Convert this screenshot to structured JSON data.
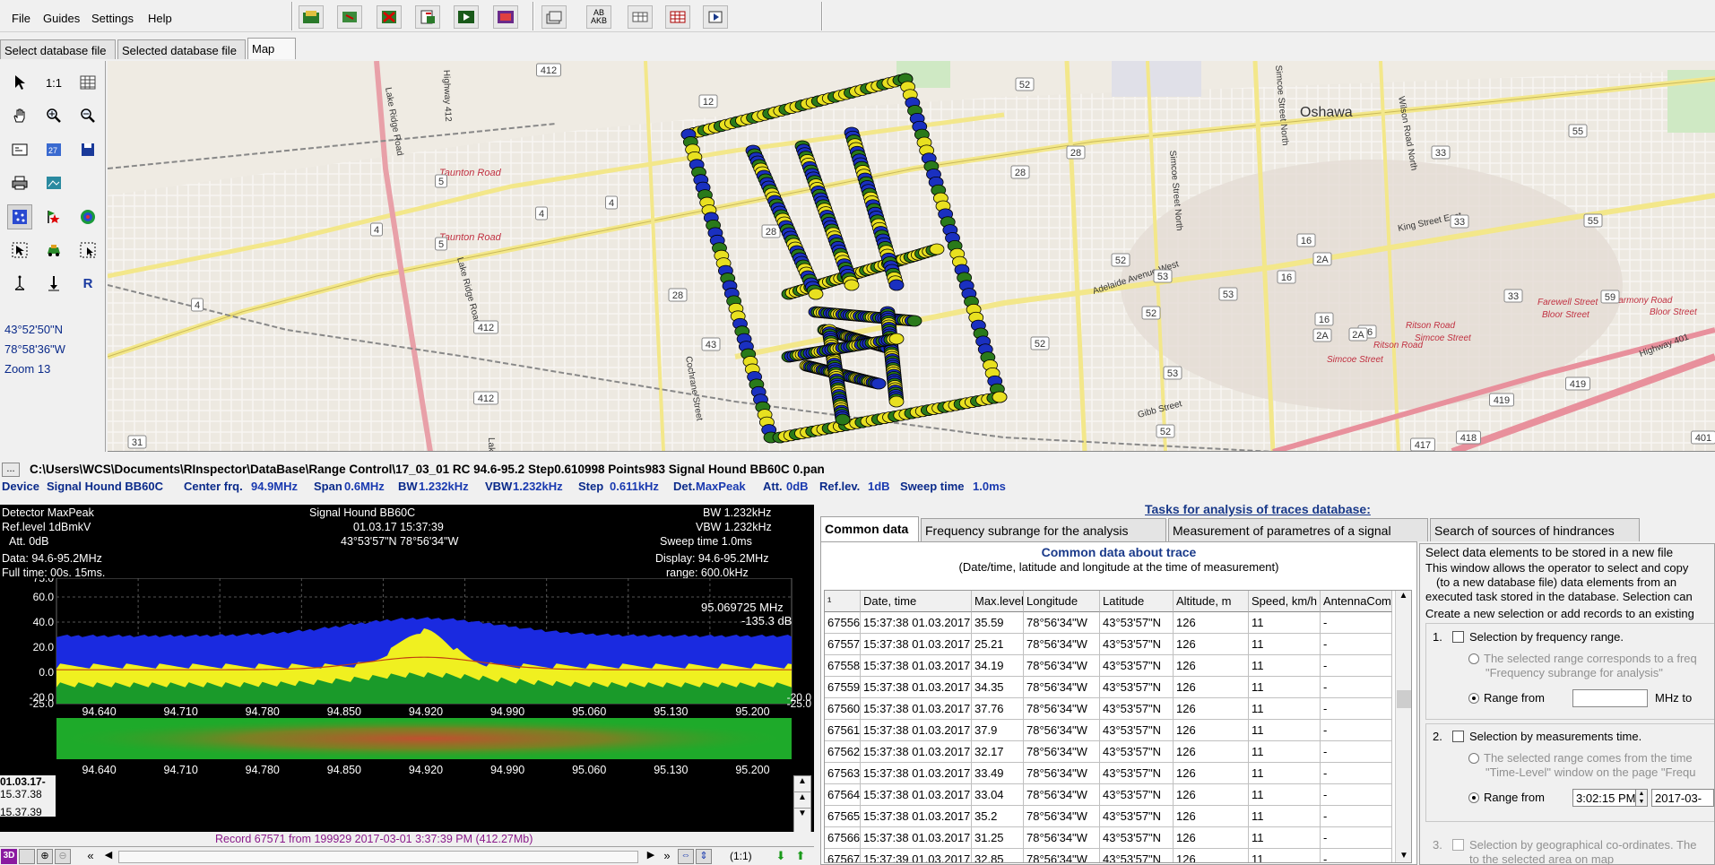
{
  "menu": [
    "File",
    "Guides",
    "Settings",
    "Help"
  ],
  "toolbar": {
    "abc_label": "AB\nAKB"
  },
  "tabs": [
    "Select database file",
    "Selected database file",
    "Map"
  ],
  "left_tools": {
    "scale_label": "1:1",
    "r_label": "R"
  },
  "coords": {
    "lat": "43°52'50\"N",
    "lon": "78°58'36\"W",
    "zoom": "Zoom 13"
  },
  "map": {
    "city": "Oshawa",
    "streets": [
      "Taunton Road",
      "Taunton Road",
      "Lake Ridge Road",
      "Lake Ridge Road",
      "Highway 412",
      "Adelaide Avenue West",
      "King Street East",
      "Gibb Street",
      "Simcoe Street North",
      "Simcoe Street North",
      "Wilson Road North",
      "Cochrane Street",
      "Farewell Street",
      "Bloor Street",
      "Harmony Road",
      "Bloor Street",
      "Ritson Road",
      "Simcoe Street",
      "Ritson Road",
      "Simcoe Street",
      "Highway 401",
      "Lake"
    ],
    "route_badges": [
      "412",
      "12",
      "4",
      "4",
      "4",
      "4",
      "412",
      "5",
      "5",
      "28",
      "28",
      "28",
      "28",
      "52",
      "52",
      "52",
      "52",
      "52",
      "53",
      "53",
      "53",
      "43",
      "16",
      "16",
      "16",
      "16",
      "2A",
      "2A",
      "2A",
      "33",
      "33",
      "33",
      "55",
      "55",
      "59",
      "412",
      "419",
      "419",
      "418",
      "417",
      "401",
      "31"
    ]
  },
  "pathbar": {
    "button": "...",
    "path": "C:\\Users\\WCS\\Documents\\RInspector\\DataBase\\Range Control\\17_03_01 RC 94.6-95.2 Step0.610998 Points983 Signal Hound BB60C 0.pan"
  },
  "devbar": {
    "device_label": "Device",
    "device": "Signal Hound BB60C",
    "center_label": "Center frq.",
    "center": "94.9MHz",
    "span_label": "Span",
    "span": "0.6MHz",
    "bw_label": "BW",
    "bw": "1.232kHz",
    "vbw_label": "VBW",
    "vbw": "1.232kHz",
    "step_label": "Step",
    "step": "0.611kHz",
    "det_label": "Det.",
    "det": "MaxPeak",
    "att_label": "Att.",
    "att": "0dB",
    "ref_label": "Ref.lev.",
    "ref": "1dB",
    "sweep_label": "Sweep time",
    "sweep": "1.0ms"
  },
  "spectrum": {
    "detector": "Detector MaxPeak",
    "reflevel": "Ref.level  1dBmkV",
    "att": "Att.  0dB",
    "data": "Data:     94.6-95.2MHz",
    "fulltime": "Full time:  00s. 15ms.",
    "device": "Signal Hound BB60C",
    "datetime": "01.03.17 15:37:39",
    "location": "43°53'57\"N  78°56'34\"W",
    "bw": "BW   1.232kHz",
    "vbw": "VBW   1.232kHz",
    "sweep": "Sweep time   1.0ms",
    "display": "Display:   94.6-95.2MHz",
    "range": "range:  600.0kHz",
    "marker_freq": "95.069725 MHz",
    "marker_level": "-135.3 dB",
    "y_ticks": [
      "75.0",
      "60.0",
      "40.0",
      "20.0",
      "0.0",
      "-20.0",
      "-25.0"
    ],
    "y_ticks_right": [
      "-20.0",
      "-25.0"
    ],
    "x_ticks": [
      "94.640",
      "94.710",
      "94.780",
      "94.850",
      "94.920",
      "94.990",
      "95.060",
      "95.130",
      "95.200"
    ],
    "wf_label1": "01.03.17-",
    "wf_label2": "15.37.38",
    "wf_label3": "15.37.39",
    "record": "Record 67571  from 199929   2017-03-01 3:37:39 PM (412.27Mb)",
    "ratio": "(1:1)",
    "bottom_3d": "3D"
  },
  "right": {
    "heading": "Tasks for analysis of traces database:",
    "tabs": [
      "Common data",
      "Frequency subrange for the analysis",
      "Measurement of parametres of a signal",
      "Search of sources of hindrances"
    ],
    "title": "Common data about trace",
    "subtitle": "(Date/time, latitude and longitude at the time of measurement)",
    "columns": [
      "¹",
      "Date, time",
      "Max.level",
      "Longitude",
      "Latitude",
      "Altitude, m",
      "Speed, km/h",
      "AntennaCom"
    ],
    "rows": [
      [
        "67556",
        "15:37:38 01.03.2017",
        "35.59",
        "78°56'34\"W",
        "43°53'57\"N",
        "126",
        "11",
        "-"
      ],
      [
        "67557",
        "15:37:38 01.03.2017",
        "25.21",
        "78°56'34\"W",
        "43°53'57\"N",
        "126",
        "11",
        "-"
      ],
      [
        "67558",
        "15:37:38 01.03.2017",
        "34.19",
        "78°56'34\"W",
        "43°53'57\"N",
        "126",
        "11",
        "-"
      ],
      [
        "67559",
        "15:37:38 01.03.2017",
        "34.35",
        "78°56'34\"W",
        "43°53'57\"N",
        "126",
        "11",
        "-"
      ],
      [
        "67560",
        "15:37:38 01.03.2017",
        "37.76",
        "78°56'34\"W",
        "43°53'57\"N",
        "126",
        "11",
        "-"
      ],
      [
        "67561",
        "15:37:38 01.03.2017",
        "37.9",
        "78°56'34\"W",
        "43°53'57\"N",
        "126",
        "11",
        "-"
      ],
      [
        "67562",
        "15:37:38 01.03.2017",
        "32.17",
        "78°56'34\"W",
        "43°53'57\"N",
        "126",
        "11",
        "-"
      ],
      [
        "67563",
        "15:37:38 01.03.2017",
        "33.49",
        "78°56'34\"W",
        "43°53'57\"N",
        "126",
        "11",
        "-"
      ],
      [
        "67564",
        "15:37:38 01.03.2017",
        "33.04",
        "78°56'34\"W",
        "43°53'57\"N",
        "126",
        "11",
        "-"
      ],
      [
        "67565",
        "15:37:38 01.03.2017",
        "35.2",
        "78°56'34\"W",
        "43°53'57\"N",
        "126",
        "11",
        "-"
      ],
      [
        "67566",
        "15:37:38 01.03.2017",
        "31.25",
        "78°56'34\"W",
        "43°53'57\"N",
        "126",
        "11",
        "-"
      ],
      [
        "67567",
        "15:37:39 01.03.2017",
        "32.85",
        "78°56'34\"W",
        "43°53'57\"N",
        "126",
        "11",
        "-"
      ]
    ],
    "sel_title": "Select data elements to be stored in a new file",
    "sel_desc1": "This window allows the operator to select and copy",
    "sel_desc2": "(to a new database file) data elements from an",
    "sel_desc3": "executed task stored in the database. Selection can",
    "sel_create": "Create a new selection or add records to an existing",
    "opt1_num": "1.",
    "opt1": "Selection by frequency range.",
    "opt1_a1": "The selected range corresponds to a freq",
    "opt1_a2": "\"Frequency subrange for analysis\"",
    "opt1_b": "Range from",
    "opt1_b2": "MHz to",
    "opt2_num": "2.",
    "opt2": "Selection by measurements time.",
    "opt2_a1": "The selected range comes from the time",
    "opt2_a2": "\"Time-Level\" window on the page \"Frequ",
    "opt2_b": "Range from",
    "opt2_time": "3:02:15 PM",
    "opt2_date": "2017-03-",
    "opt3_num": "3.",
    "opt3_a1": "Selection by geographical co-ordinates. The",
    "opt3_a2": "to the selected area on map"
  }
}
